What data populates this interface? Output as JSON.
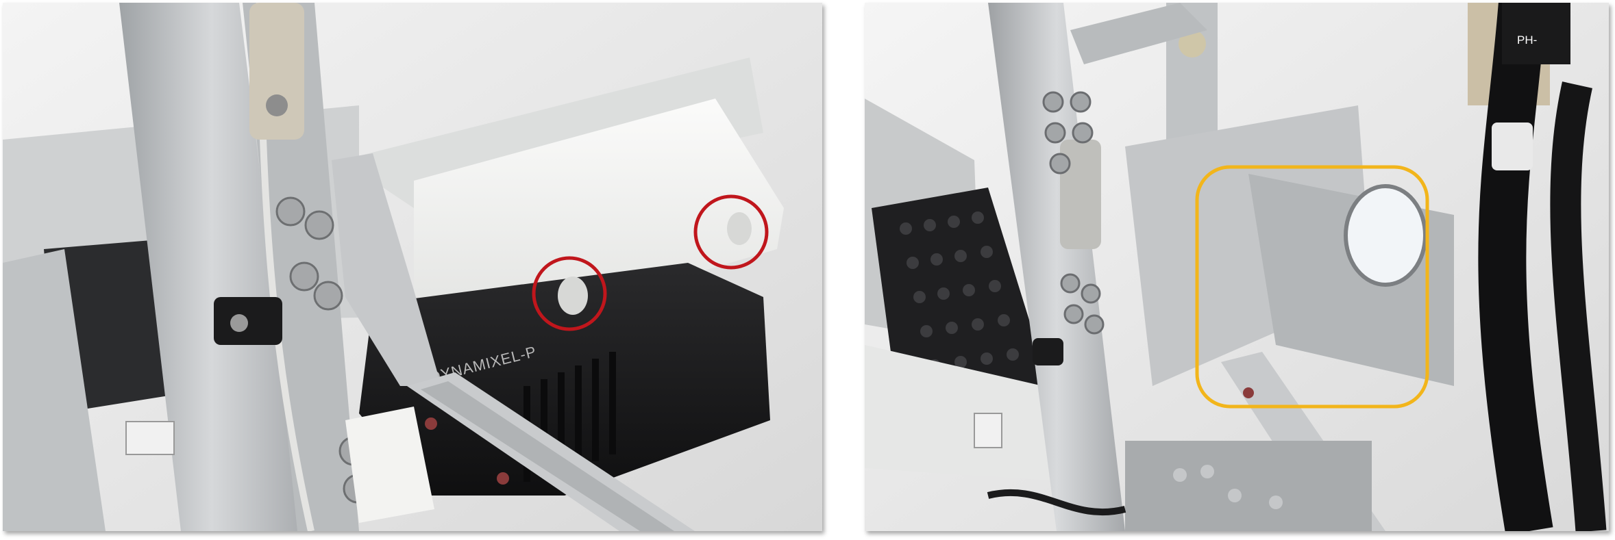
{
  "panels": [
    {
      "id": "left",
      "printed_text": "DYNAMIXEL-P",
      "annotations": [
        {
          "shape": "circle",
          "color": "#c0161c"
        },
        {
          "shape": "circle",
          "color": "#c0161c"
        }
      ]
    },
    {
      "id": "right",
      "printed_text": "PH-",
      "annotations": [
        {
          "shape": "rounded-rectangle",
          "color": "#f2b51b"
        }
      ]
    }
  ],
  "colors": {
    "annotation_red": "#c0161c",
    "annotation_yellow": "#f2b51b",
    "aluminum": "#c3c6c8",
    "plastic_white": "#f4f4f2",
    "servo_black": "#1c1c1e"
  }
}
